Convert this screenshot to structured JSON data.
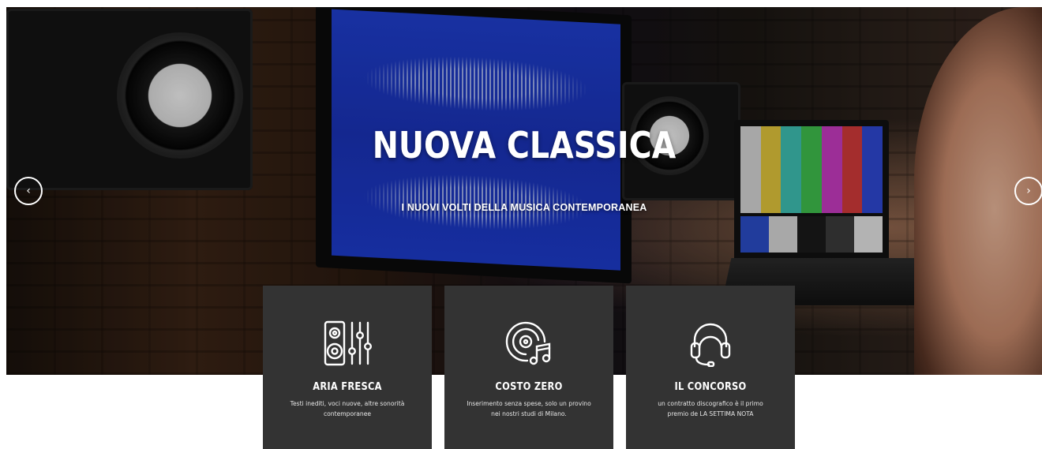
{
  "hero": {
    "title": "NUOVA CLASSICA",
    "subtitle": "I NUOVI VOLTI DELLA MUSICA CONTEMPORANEA",
    "prev_icon": "chevron-left-icon",
    "next_icon": "chevron-right-icon",
    "prev_glyph": "‹",
    "next_glyph": "›"
  },
  "features": [
    {
      "icon": "speaker-mixer-icon",
      "title": "ARIA FRESCA",
      "text": "Testi inediti, voci nuove, altre sonorità contemporanee"
    },
    {
      "icon": "vinyl-music-icon",
      "title": "COSTO ZERO",
      "text": "Inserimento senza spese, solo un provino nei nostri studi di Milano."
    },
    {
      "icon": "headphones-icon",
      "title": "IL CONCORSO",
      "text": "un contratto discografico è il primo premio de LA SETTIMA NOTA"
    }
  ],
  "colors": {
    "card_background": "#333333",
    "text": "#ffffff",
    "page_background": "#ffffff"
  }
}
